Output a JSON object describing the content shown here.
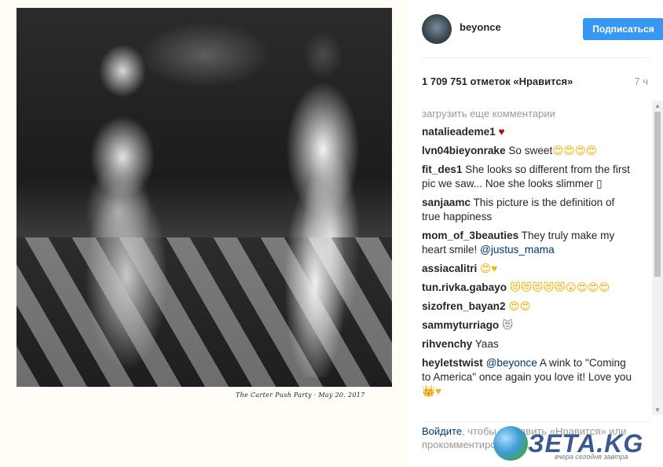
{
  "photo": {
    "caption": "The Carter Push Party · May 20. 2017"
  },
  "header": {
    "username": "beyonce",
    "follow_label": "Подписаться"
  },
  "stats": {
    "likes": "1 709 751 отметок «Нравится»",
    "time": "7 ч"
  },
  "load_more": "загрузить еще комментарии",
  "comments": [
    {
      "user": "natalieademe1",
      "text": "",
      "emoji": "♥",
      "emoji_kind": "heart"
    },
    {
      "user": "lvn04bieyonrake",
      "text": "So sweet",
      "emoji": "😍😍😍😍",
      "emoji_kind": "smile"
    },
    {
      "user": "fit_des1",
      "text": "She looks so different from the first pic we saw... Noe she looks slimmer ▯",
      "emoji": "",
      "emoji_kind": ""
    },
    {
      "user": "sanjaamc",
      "text": "This picture is the definition of true happiness",
      "emoji": "",
      "emoji_kind": ""
    },
    {
      "user": "mom_of_3beauties",
      "text": "They truly make my heart smile!",
      "mention": "@justus_mama",
      "emoji": "",
      "emoji_kind": ""
    },
    {
      "user": "assiacalitri",
      "text": "",
      "emoji": "😍♥",
      "emoji_kind": "smile"
    },
    {
      "user": "tun.rivka.gabayo",
      "text": "",
      "emoji": "😻😻😻😻😻😮😍😍😍",
      "emoji_kind": "smile"
    },
    {
      "user": "sizofren_bayan2",
      "text": "",
      "emoji": "😍😍",
      "emoji_kind": "smile"
    },
    {
      "user": "sammyturriago",
      "text": "",
      "emoji": "😻",
      "emoji_kind": "cat"
    },
    {
      "user": "rihvenchy",
      "text": "Yaas",
      "emoji": "",
      "emoji_kind": ""
    },
    {
      "user": "heyletstwist",
      "mention_first": "@beyonce",
      "text": "A wink to \"Coming to America\" once again you love it! Love you",
      "emoji": "👑♥",
      "emoji_kind": "smile"
    }
  ],
  "login_prompt": {
    "link": "Войдите",
    "text": ", чтобы поставить «Нравится» или прокомментировать."
  },
  "watermark": {
    "brand": "ЗЕТА.KG",
    "tagline": "вчера сегодня завтра"
  },
  "colors": {
    "follow_button": "#3897f0",
    "link": "#003569",
    "muted": "#999999"
  }
}
